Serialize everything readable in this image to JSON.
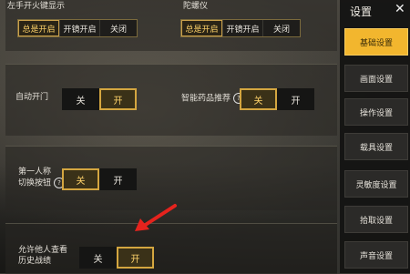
{
  "sidebar": {
    "title": "设置",
    "close_label": "✕",
    "items": [
      {
        "label": "基础设置",
        "active": true
      },
      {
        "label": "画面设置",
        "active": false
      },
      {
        "label": "操作设置",
        "active": false
      },
      {
        "label": "载具设置",
        "active": false
      },
      {
        "label": "灵敏度设置",
        "active": false
      },
      {
        "label": "拾取设置",
        "active": false
      },
      {
        "label": "声音设置",
        "active": false
      }
    ]
  },
  "settings": {
    "left_fire": {
      "label": "左手开火键显示",
      "options": [
        "总是开启",
        "开镜开启",
        "关闭"
      ],
      "selected": "总是开启"
    },
    "gyro": {
      "label": "陀螺仪",
      "options": [
        "总是开启",
        "开镜开启",
        "关闭"
      ],
      "selected": "总是开启"
    },
    "auto_door": {
      "label": "自动开门",
      "off": "关",
      "on": "开",
      "selected": "开"
    },
    "smart_med": {
      "label": "智能药品推荐",
      "help": "?",
      "off": "关",
      "on": "开",
      "selected": "关"
    },
    "fpp_switch": {
      "label_line1": "第一人称",
      "label_line2": "切换按钮",
      "help": "?",
      "off": "关",
      "on": "开",
      "selected": "关"
    },
    "history": {
      "label_line1": "允许他人查看",
      "label_line2": "历史战绩",
      "off": "关",
      "on": "开",
      "selected": "开"
    }
  },
  "colors": {
    "accent": "#f2b62e",
    "selected_border": "#d4a640",
    "arrow": "#e5231d"
  }
}
